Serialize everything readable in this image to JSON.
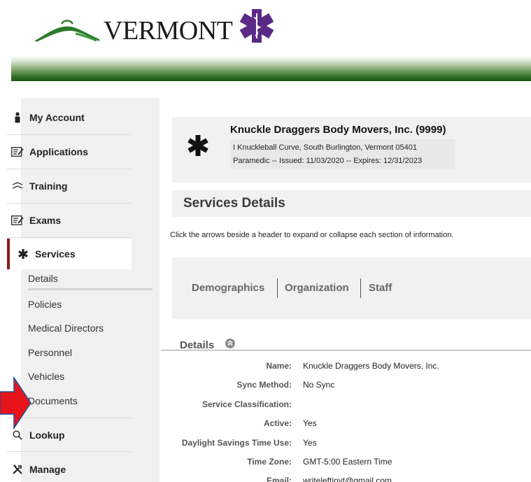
{
  "header": {
    "brand": "VERMONT",
    "colors": {
      "banner_dark": "#1f5a15",
      "banner_mid": "#7ea66a",
      "star": "#5b2a86",
      "mountain": "#2d7a2d"
    }
  },
  "sidebar": {
    "items": [
      {
        "label": "My Account",
        "icon": "person-icon"
      },
      {
        "label": "Applications",
        "icon": "edit-document-icon"
      },
      {
        "label": "Training",
        "icon": "training-icon"
      },
      {
        "label": "Exams",
        "icon": "edit-document-icon"
      },
      {
        "label": "Services",
        "icon": "asterisk-icon",
        "active": true
      },
      {
        "label": "Lookup",
        "icon": "search-icon"
      },
      {
        "label": "Manage",
        "icon": "tools-icon"
      }
    ],
    "sub_items": [
      {
        "label": "Details",
        "active": true
      },
      {
        "label": "Policies"
      },
      {
        "label": "Medical Directors"
      },
      {
        "label": "Personnel"
      },
      {
        "label": "Vehicles"
      },
      {
        "label": "Documents"
      }
    ],
    "active_color": "#8b1a1a"
  },
  "profile": {
    "name": "Knuckle Draggers Body Movers, Inc. (9999)",
    "address": "I Knuckleball Curve, South Burlington, Vermont 05401",
    "license": "Paramedic -- Issued: 11/03/2020 -- Expires: 12/31/2023"
  },
  "page": {
    "title": "Services Details",
    "instructions": "Click the arrows beside a header to expand or collapse each section of information."
  },
  "tabs": [
    "Demographics",
    "Organization",
    "Staff"
  ],
  "details": {
    "heading": "Details",
    "fields": [
      {
        "label": "Name:",
        "value": "Knuckle Draggers Body Movers, Inc."
      },
      {
        "label": "Sync Method:",
        "value": "No Sync"
      },
      {
        "label": "Service Classification:",
        "value": ""
      },
      {
        "label": "Active:",
        "value": "Yes"
      },
      {
        "label": "Daylight Savings Time Use:",
        "value": "Yes"
      },
      {
        "label": "Time Zone:",
        "value": "GMT-5:00 Eastern Time"
      },
      {
        "label": "Email:",
        "value": "writeleftinvt@gmail.com"
      }
    ]
  },
  "annotation": {
    "arrow_color": "#e8141b"
  }
}
